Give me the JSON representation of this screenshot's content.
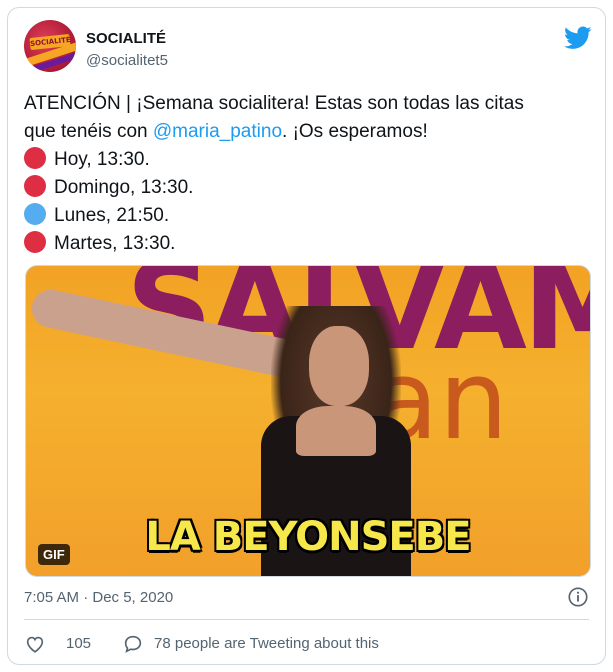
{
  "author": {
    "display_name": "SOCIALITÉ",
    "handle": "@socialitet5",
    "avatar_text": "SOCIALITÉ"
  },
  "tweet": {
    "intro_part1": "ATENCIÓN | ¡Semana socialitera! Estas son todas las citas",
    "intro_part2_before": "que tenéis con ",
    "mention": "@maria_patino",
    "intro_part2_after": ". ¡Os esperamos!",
    "schedule": [
      {
        "color": "#dd2e44",
        "text": "Hoy, 13:30."
      },
      {
        "color": "#dd2e44",
        "text": "Domingo, 13:30."
      },
      {
        "color": "#55acee",
        "text": "Lunes, 21:50."
      },
      {
        "color": "#dd2e44",
        "text": "Martes, 13:30."
      }
    ]
  },
  "media": {
    "caption": "LA BEYONSEBE",
    "badge": "GIF",
    "background_text_1": "SALVAM",
    "background_text_2": "ran"
  },
  "meta": {
    "timestamp": "7:05 AM · Dec 5, 2020"
  },
  "actions": {
    "like_count": "105",
    "reply_text": "78 people are Tweeting about this"
  },
  "colors": {
    "accent": "#1d9bf0",
    "muted": "#536471",
    "border": "#cfd9de"
  }
}
